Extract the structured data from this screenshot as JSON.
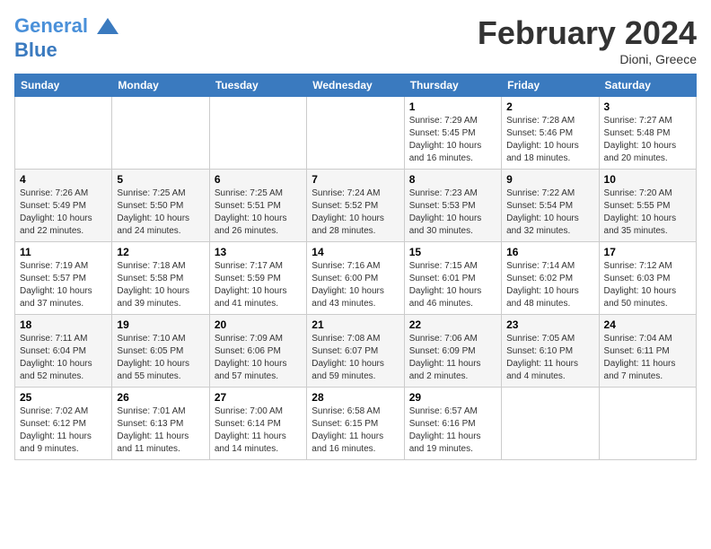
{
  "header": {
    "logo_line1": "General",
    "logo_line2": "Blue",
    "month_title": "February 2024",
    "subtitle": "Dioni, Greece"
  },
  "days_of_week": [
    "Sunday",
    "Monday",
    "Tuesday",
    "Wednesday",
    "Thursday",
    "Friday",
    "Saturday"
  ],
  "weeks": [
    [
      {
        "num": "",
        "info": ""
      },
      {
        "num": "",
        "info": ""
      },
      {
        "num": "",
        "info": ""
      },
      {
        "num": "",
        "info": ""
      },
      {
        "num": "1",
        "info": "Sunrise: 7:29 AM\nSunset: 5:45 PM\nDaylight: 10 hours\nand 16 minutes."
      },
      {
        "num": "2",
        "info": "Sunrise: 7:28 AM\nSunset: 5:46 PM\nDaylight: 10 hours\nand 18 minutes."
      },
      {
        "num": "3",
        "info": "Sunrise: 7:27 AM\nSunset: 5:48 PM\nDaylight: 10 hours\nand 20 minutes."
      }
    ],
    [
      {
        "num": "4",
        "info": "Sunrise: 7:26 AM\nSunset: 5:49 PM\nDaylight: 10 hours\nand 22 minutes."
      },
      {
        "num": "5",
        "info": "Sunrise: 7:25 AM\nSunset: 5:50 PM\nDaylight: 10 hours\nand 24 minutes."
      },
      {
        "num": "6",
        "info": "Sunrise: 7:25 AM\nSunset: 5:51 PM\nDaylight: 10 hours\nand 26 minutes."
      },
      {
        "num": "7",
        "info": "Sunrise: 7:24 AM\nSunset: 5:52 PM\nDaylight: 10 hours\nand 28 minutes."
      },
      {
        "num": "8",
        "info": "Sunrise: 7:23 AM\nSunset: 5:53 PM\nDaylight: 10 hours\nand 30 minutes."
      },
      {
        "num": "9",
        "info": "Sunrise: 7:22 AM\nSunset: 5:54 PM\nDaylight: 10 hours\nand 32 minutes."
      },
      {
        "num": "10",
        "info": "Sunrise: 7:20 AM\nSunset: 5:55 PM\nDaylight: 10 hours\nand 35 minutes."
      }
    ],
    [
      {
        "num": "11",
        "info": "Sunrise: 7:19 AM\nSunset: 5:57 PM\nDaylight: 10 hours\nand 37 minutes."
      },
      {
        "num": "12",
        "info": "Sunrise: 7:18 AM\nSunset: 5:58 PM\nDaylight: 10 hours\nand 39 minutes."
      },
      {
        "num": "13",
        "info": "Sunrise: 7:17 AM\nSunset: 5:59 PM\nDaylight: 10 hours\nand 41 minutes."
      },
      {
        "num": "14",
        "info": "Sunrise: 7:16 AM\nSunset: 6:00 PM\nDaylight: 10 hours\nand 43 minutes."
      },
      {
        "num": "15",
        "info": "Sunrise: 7:15 AM\nSunset: 6:01 PM\nDaylight: 10 hours\nand 46 minutes."
      },
      {
        "num": "16",
        "info": "Sunrise: 7:14 AM\nSunset: 6:02 PM\nDaylight: 10 hours\nand 48 minutes."
      },
      {
        "num": "17",
        "info": "Sunrise: 7:12 AM\nSunset: 6:03 PM\nDaylight: 10 hours\nand 50 minutes."
      }
    ],
    [
      {
        "num": "18",
        "info": "Sunrise: 7:11 AM\nSunset: 6:04 PM\nDaylight: 10 hours\nand 52 minutes."
      },
      {
        "num": "19",
        "info": "Sunrise: 7:10 AM\nSunset: 6:05 PM\nDaylight: 10 hours\nand 55 minutes."
      },
      {
        "num": "20",
        "info": "Sunrise: 7:09 AM\nSunset: 6:06 PM\nDaylight: 10 hours\nand 57 minutes."
      },
      {
        "num": "21",
        "info": "Sunrise: 7:08 AM\nSunset: 6:07 PM\nDaylight: 10 hours\nand 59 minutes."
      },
      {
        "num": "22",
        "info": "Sunrise: 7:06 AM\nSunset: 6:09 PM\nDaylight: 11 hours\nand 2 minutes."
      },
      {
        "num": "23",
        "info": "Sunrise: 7:05 AM\nSunset: 6:10 PM\nDaylight: 11 hours\nand 4 minutes."
      },
      {
        "num": "24",
        "info": "Sunrise: 7:04 AM\nSunset: 6:11 PM\nDaylight: 11 hours\nand 7 minutes."
      }
    ],
    [
      {
        "num": "25",
        "info": "Sunrise: 7:02 AM\nSunset: 6:12 PM\nDaylight: 11 hours\nand 9 minutes."
      },
      {
        "num": "26",
        "info": "Sunrise: 7:01 AM\nSunset: 6:13 PM\nDaylight: 11 hours\nand 11 minutes."
      },
      {
        "num": "27",
        "info": "Sunrise: 7:00 AM\nSunset: 6:14 PM\nDaylight: 11 hours\nand 14 minutes."
      },
      {
        "num": "28",
        "info": "Sunrise: 6:58 AM\nSunset: 6:15 PM\nDaylight: 11 hours\nand 16 minutes."
      },
      {
        "num": "29",
        "info": "Sunrise: 6:57 AM\nSunset: 6:16 PM\nDaylight: 11 hours\nand 19 minutes."
      },
      {
        "num": "",
        "info": ""
      },
      {
        "num": "",
        "info": ""
      }
    ]
  ]
}
